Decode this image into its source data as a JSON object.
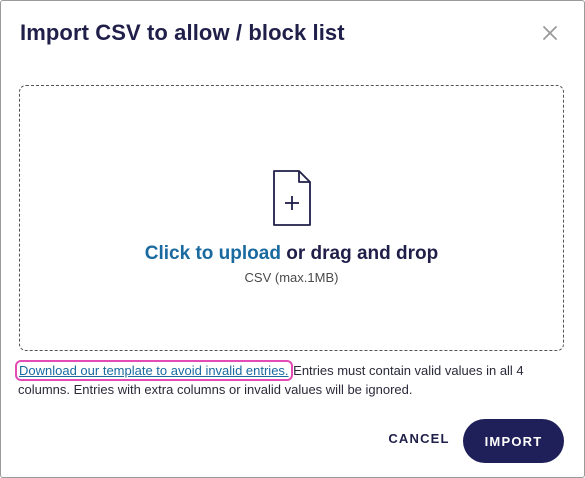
{
  "dialog": {
    "title": "Import CSV to allow / block list",
    "close_icon": "close-icon"
  },
  "dropzone": {
    "icon": "file-add-icon",
    "upload_link": "Click to upload",
    "upload_rest": " or drag and drop",
    "hint": "CSV (max.1MB)"
  },
  "info": {
    "template_link": "Download our template to avoid invalid entries.",
    "text": " Entries must contain valid values in all 4 columns. Entries with extra columns or invalid values will be ignored."
  },
  "actions": {
    "cancel_label": "CANCEL",
    "import_label": "IMPORT"
  },
  "colors": {
    "title": "#1f1f4a",
    "link": "#1a6aa0",
    "primary_button": "#1f1f5a",
    "highlight": "#e24cb4"
  }
}
